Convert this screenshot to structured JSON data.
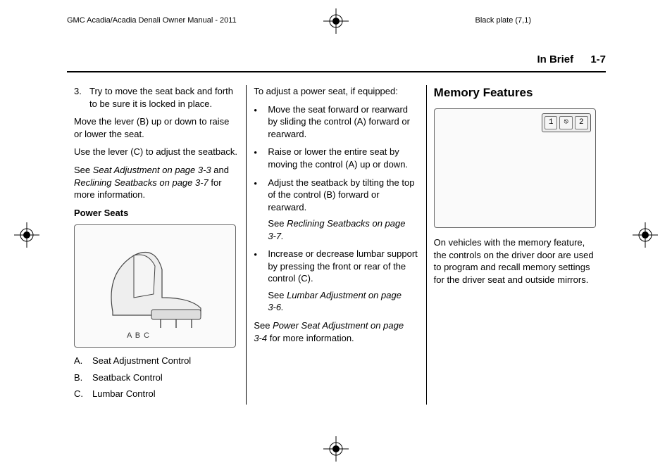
{
  "meta": {
    "top_left": "GMC Acadia/Acadia Denali Owner Manual - 2011",
    "top_right": "Black plate (7,1)"
  },
  "header": {
    "section": "In Brief",
    "page": "1-7"
  },
  "col1": {
    "step3_num": "3.",
    "step3": "Try to move the seat back and forth to be sure it is locked in place.",
    "p1": "Move the lever (B) up or down to raise or lower the seat.",
    "p2": "Use the lever (C) to adjust the seatback.",
    "see_lead": "See ",
    "see_ref1": "Seat Adjustment on page 3‑3",
    "see_mid": " and ",
    "see_ref2": "Reclining Seatbacks on page 3‑7",
    "see_tail": " for more information.",
    "subhead": "Power Seats",
    "fig_letters": "A    B    C",
    "li_a_n": "A.",
    "li_a": "Seat Adjustment Control",
    "li_b_n": "B.",
    "li_b": "Seatback Control",
    "li_c_n": "C.",
    "li_c": "Lumbar Control"
  },
  "col2": {
    "intro": "To adjust a power seat, if equipped:",
    "b1": "Move the seat forward or rearward by sliding the control (A) forward or rearward.",
    "b2": "Raise or lower the entire seat by moving the control (A) up or down.",
    "b3": "Adjust the seatback by tilting the top of the control (B) forward or rearward.",
    "b3_see_lead": "See ",
    "b3_see_ref": "Reclining Seatbacks on page 3‑7.",
    "b4": "Increase or decrease lumbar support by pressing the front or rear of the control (C).",
    "b4_see_lead": "See ",
    "b4_see_ref": "Lumbar Adjustment on page 3‑6.",
    "foot_lead": "See ",
    "foot_ref": "Power Seat Adjustment on page 3‑4",
    "foot_tail": " for more information."
  },
  "col3": {
    "heading": "Memory Features",
    "mem_btn1": "1",
    "mem_btn_mid": "⎋",
    "mem_btn2": "2",
    "p1": "On vehicles with the memory feature, the controls on the driver door are used to program and recall memory settings for the driver seat and outside mirrors."
  }
}
